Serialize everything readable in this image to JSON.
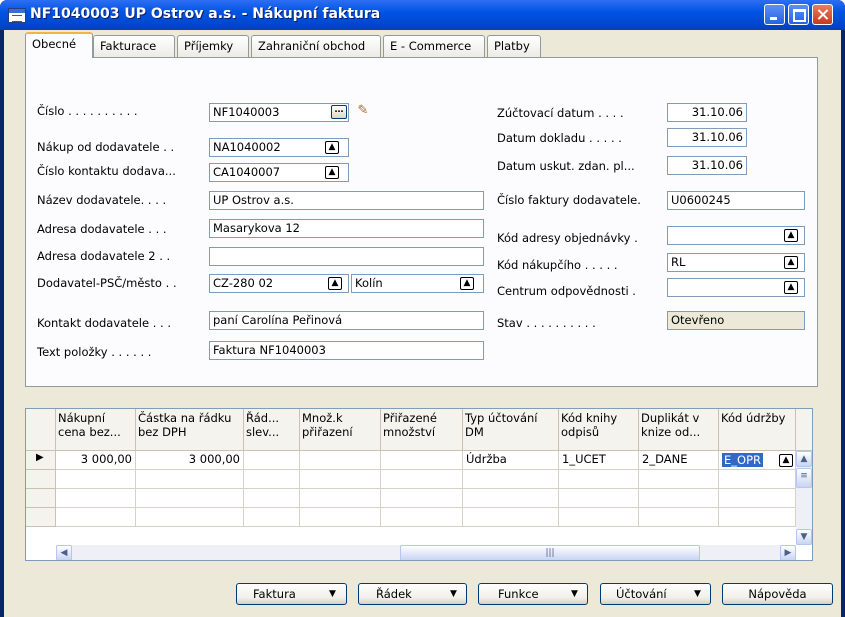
{
  "window": {
    "title": "NF1040003 UP Ostrov a.s. - Nákupní faktura"
  },
  "tabs": [
    "Obecné",
    "Fakturace",
    "Příjemky",
    "Zahraniční obchod",
    "E - Commerce",
    "Platby"
  ],
  "left_fields": [
    {
      "label": "Číslo . . . . . . . . . .",
      "value": "NF1040003"
    },
    {
      "label": "Nákup od dodavatele . .",
      "value": "NA1040002"
    },
    {
      "label": "Číslo kontaktu dodava...",
      "value": "CA1040007"
    },
    {
      "label": "Název dodavatele. . . .",
      "value": "UP Ostrov a.s."
    },
    {
      "label": "Adresa dodavatele . . .",
      "value": "Masarykova 12"
    },
    {
      "label": "Adresa dodavatele 2 . .",
      "value": ""
    },
    {
      "label": "Dodavatel-PSČ/město . .",
      "value": "CZ-280 02",
      "value2": "Kolín"
    },
    {
      "label": "Kontakt dodavatele . . .",
      "value": "paní Carolína Peřinová"
    },
    {
      "label": "Text položky . . . . . .",
      "value": "Faktura NF1040003"
    }
  ],
  "right_fields": [
    {
      "label": "Zúčtovací datum . . . .",
      "value": "31.10.06"
    },
    {
      "label": "Datum dokladu . . . . .",
      "value": "31.10.06"
    },
    {
      "label": "Datum uskut. zdan. pl...",
      "value": "31.10.06"
    },
    {
      "label": "Číslo faktury dodavatele.",
      "value": "U0600245"
    },
    {
      "label": "Kód adresy objednávky .",
      "value": ""
    },
    {
      "label": "Kód nákupčího . . . . .",
      "value": "RL"
    },
    {
      "label": "Centrum odpovědnosti .",
      "value": ""
    },
    {
      "label": "Stav . . . . . . . . . .",
      "value": "Otevřeno"
    }
  ],
  "lines": {
    "headers": [
      "Nákupní cena bez...",
      "Částka na řádku bez DPH",
      "Řád... slev...",
      "Množ.k přiřazení",
      "Přiřazené množství",
      "Typ účtování DM",
      "Kód knihy odpisů",
      "Duplikát v knize od...",
      "Kód údržby"
    ],
    "rows": [
      [
        "3 000,00",
        "3 000,00",
        "",
        "",
        "",
        "Údržba",
        "1_UCET",
        "2_DANE",
        "E_OPR"
      ]
    ]
  },
  "buttons": {
    "faktura": "Faktura",
    "radek": "Řádek",
    "funkce": "Funkce",
    "uctovani": "Účtování",
    "napoveda": "Nápověda"
  }
}
